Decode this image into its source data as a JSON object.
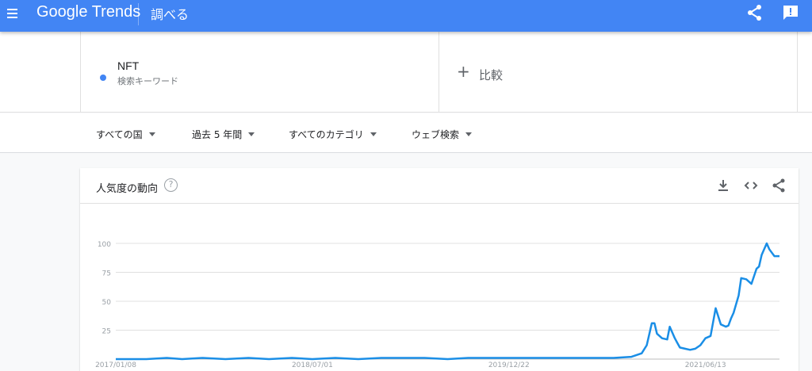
{
  "header": {
    "logo_google": "Google",
    "logo_trends": "Trends",
    "page_label": "調べる",
    "accent_color": "#4285f4"
  },
  "search": {
    "term": "NFT",
    "term_type": "検索キーワード",
    "term_color": "#4285f4",
    "compare_label": "比較",
    "compare_icon": "plus-icon"
  },
  "filters": {
    "region": "すべての国",
    "period": "過去 5 年間",
    "category": "すべてのカテゴリ",
    "search_type": "ウェブ検索"
  },
  "card": {
    "title": "人気度の動向",
    "help": "?"
  },
  "chart_data": {
    "type": "line",
    "title": "",
    "xlabel": "",
    "ylabel": "",
    "ylim": [
      0,
      100
    ],
    "yticks": [
      25,
      50,
      75,
      100
    ],
    "xtick_labels": [
      "2017/01/08",
      "2018/07/01",
      "2019/12/22",
      "2021/06/13"
    ],
    "xtick_dates": [
      "2017-01-08",
      "2018-07-01",
      "2019-12-22",
      "2021-06-13"
    ],
    "grid": true,
    "line_color": "#1a8ee6",
    "series": [
      {
        "name": "NFT",
        "x": [
          "2017-01-08",
          "2017-04-02",
          "2017-05-28",
          "2017-07-09",
          "2017-09-03",
          "2017-11-05",
          "2018-01-07",
          "2018-03-04",
          "2018-05-06",
          "2018-07-01",
          "2018-09-02",
          "2018-11-04",
          "2019-01-06",
          "2019-03-03",
          "2019-05-05",
          "2019-07-07",
          "2019-09-01",
          "2019-11-03",
          "2019-12-22",
          "2020-02-02",
          "2020-04-05",
          "2020-06-07",
          "2020-08-02",
          "2020-10-04",
          "2020-11-22",
          "2020-12-20",
          "2021-01-03",
          "2021-01-17",
          "2021-01-24",
          "2021-01-31",
          "2021-02-14",
          "2021-02-28",
          "2021-03-07",
          "2021-03-21",
          "2021-03-28",
          "2021-04-04",
          "2021-04-18",
          "2021-05-02",
          "2021-05-16",
          "2021-05-30",
          "2021-06-13",
          "2021-06-27",
          "2021-07-11",
          "2021-07-25",
          "2021-08-08",
          "2021-08-15",
          "2021-08-22",
          "2021-08-29",
          "2021-09-12",
          "2021-09-19",
          "2021-10-03",
          "2021-10-17",
          "2021-10-31",
          "2021-11-07",
          "2021-11-14",
          "2021-11-28",
          "2021-12-05",
          "2021-12-12",
          "2021-12-19",
          "2022-01-02"
        ],
        "values": [
          0,
          0,
          1,
          0,
          1,
          0,
          1,
          0,
          1,
          0,
          1,
          0,
          1,
          1,
          1,
          0,
          1,
          1,
          1,
          1,
          1,
          1,
          1,
          1,
          2,
          5,
          12,
          31,
          31,
          22,
          18,
          17,
          28,
          18,
          14,
          10,
          9,
          8,
          9,
          12,
          18,
          20,
          44,
          30,
          28,
          29,
          35,
          40,
          55,
          70,
          69,
          65,
          78,
          80,
          90,
          100,
          95,
          92,
          89,
          89
        ]
      }
    ]
  }
}
